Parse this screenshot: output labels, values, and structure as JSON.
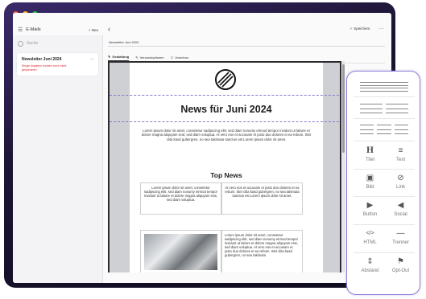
{
  "window": {
    "mail_label": "E-Mails",
    "new_label": "+ Neu",
    "back_glyph": "‹",
    "save_label": "✓ Speichern",
    "more_glyph": "···"
  },
  "sidebar": {
    "search_placeholder": "Suche",
    "items": [
      {
        "title": "Newsletter Juni 2024",
        "error": "Einige Angaben wurden noch nicht gespeichert",
        "more": "..."
      }
    ]
  },
  "editor": {
    "subject": "Newsletter Juni 2024",
    "tabs": [
      {
        "icon": "✎",
        "label": "Gestaltung"
      },
      {
        "icon": "✎",
        "label": "Versandoptionen"
      },
      {
        "icon": "☐",
        "label": "Vorschau"
      }
    ]
  },
  "newsletter": {
    "heading": "News für Juni 2024",
    "intro": "Lorem ipsum dolor sit amet, consetetur sadipscing elitr, sed diam nonumy eirmod tempor invidunt ut labore et dolore magna aliquyam erat, sed diam voluptua. At vero eos et accusam et justo duo dolores et ea rebum. Stet clita kasd gubergren, no sea takimata sanctus est Lorem ipsum dolor sit amet.",
    "top_news": "Top News",
    "col_left": "Lorem ipsum dolor sit amet, consetetur sadipscing elitr, sed diam nonumy eirmod tempor invidunt ut labore et dolore magna aliquyam erat, sed diam voluptua.",
    "col_right": "At vero eos et accusam et justo duo dolores et ea rebum. Stet clita kasd gubergren, no sea takimata sanctus est Lorem ipsum dolor sit amet.",
    "col2": "Lorem ipsum dolor sit amet, consetetur sadipscing elitr, sed diam nonumy eirmod tempor invidunt ut labore et dolore magna aliquyam erat, sed diam voluptua. At vero eos et accusam et justo duo dolores et ea rebum. Stet clita kasd gubergren, no sea takimata"
  },
  "palette": {
    "blocks": [
      {
        "icon": "H",
        "label": "Titel"
      },
      {
        "icon": "≡",
        "label": "Text"
      },
      {
        "icon": "▣",
        "label": "Bild"
      },
      {
        "icon": "⊘",
        "label": "Link"
      },
      {
        "icon": "▶",
        "label": "Button"
      },
      {
        "icon": "◀",
        "label": "Social"
      },
      {
        "icon": "</>",
        "label": "HTML"
      },
      {
        "icon": "—",
        "label": "Trenner"
      },
      {
        "icon": "⇕",
        "label": "Abstand"
      },
      {
        "icon": "⚑",
        "label": "Opt-Out"
      }
    ]
  },
  "colors": {
    "accent": "#8e7cd6",
    "error": "#d9262f"
  }
}
